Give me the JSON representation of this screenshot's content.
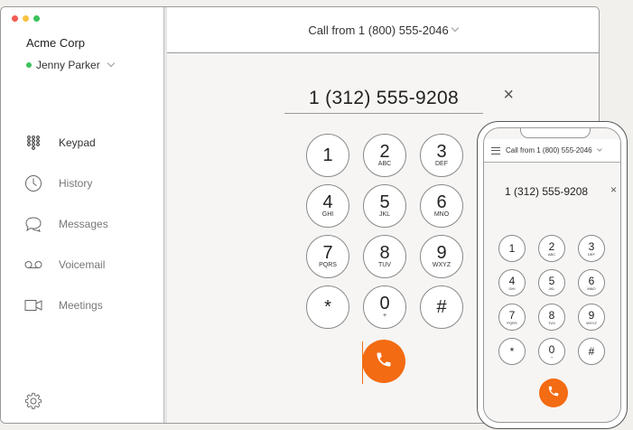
{
  "app": {
    "org_name": "Acme Corp",
    "user_name": "Jenny Parker",
    "traffic_lights": [
      "#f25c54",
      "#f7c142",
      "#3cc25a"
    ]
  },
  "sidebar": {
    "items": [
      {
        "label": "Keypad",
        "icon": "keypad-icon"
      },
      {
        "label": "History",
        "icon": "clock-icon"
      },
      {
        "label": "Messages",
        "icon": "chat-icon"
      },
      {
        "label": "Voicemail",
        "icon": "voicemail-icon"
      },
      {
        "label": "Meetings",
        "icon": "video-icon"
      }
    ],
    "settings_icon": "gear-icon"
  },
  "header": {
    "caller_id": "Call from 1 (800) 555-2046"
  },
  "dialer": {
    "number": "1 (312) 555-9208",
    "clear_symbol": "×",
    "keys": [
      {
        "digit": "1",
        "letters": ""
      },
      {
        "digit": "2",
        "letters": "ABC"
      },
      {
        "digit": "3",
        "letters": "DEF"
      },
      {
        "digit": "4",
        "letters": "GHI"
      },
      {
        "digit": "5",
        "letters": "JKL"
      },
      {
        "digit": "6",
        "letters": "MNO"
      },
      {
        "digit": "7",
        "letters": "PQRS"
      },
      {
        "digit": "8",
        "letters": "TUV"
      },
      {
        "digit": "9",
        "letters": "WXYZ"
      },
      {
        "digit": "*",
        "letters": ""
      },
      {
        "digit": "0",
        "letters": "+"
      },
      {
        "digit": "#",
        "letters": ""
      }
    ],
    "call_color": "#f36b12"
  },
  "phone": {
    "caller_id": "Call from 1 (800) 555-2046",
    "number": "1 (312) 555-9208",
    "clear_symbol": "×"
  }
}
